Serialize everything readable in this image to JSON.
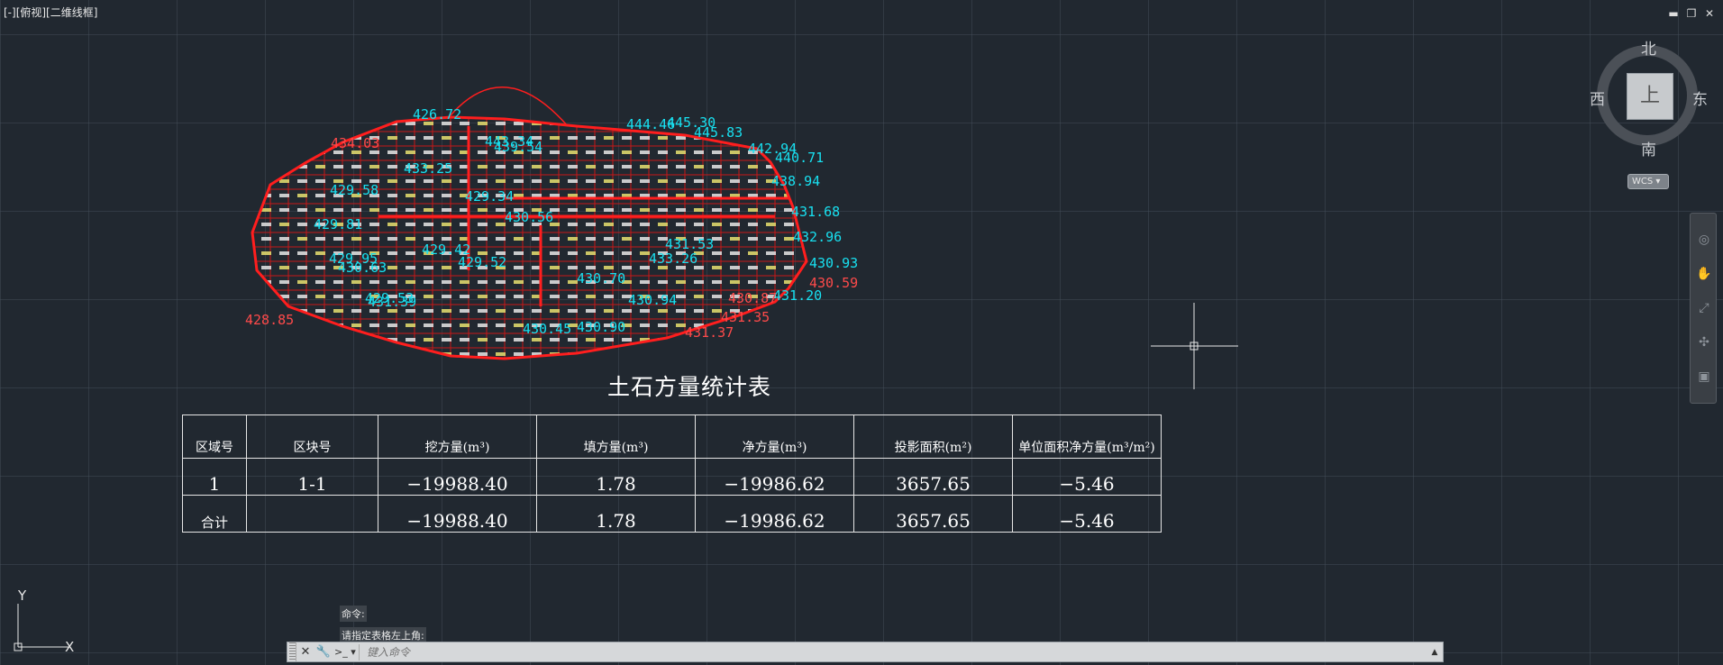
{
  "viewport": {
    "label": "[-][俯视][二维线框]"
  },
  "window_controls": {
    "minimize": "▬",
    "restore": "❐",
    "close": "✕"
  },
  "viewcube": {
    "north": "北",
    "south": "南",
    "west": "西",
    "east": "东",
    "face": "上",
    "wcs": "WCS ▾"
  },
  "navbar": {
    "icons": [
      "steering-wheel-icon",
      "pan-icon",
      "zoom-icon",
      "orbit-icon",
      "showmotion-icon"
    ]
  },
  "drawing": {
    "labels": [
      {
        "t": "426.72",
        "c": "cyan"
      },
      {
        "t": "434.03",
        "c": "red"
      },
      {
        "t": "439.54",
        "c": "cyan"
      },
      {
        "t": "443.34",
        "c": "cyan"
      },
      {
        "t": "444.46",
        "c": "cyan"
      },
      {
        "t": "445.30",
        "c": "cyan"
      },
      {
        "t": "445.83",
        "c": "cyan"
      },
      {
        "t": "442.94",
        "c": "cyan"
      },
      {
        "t": "440.71",
        "c": "cyan"
      },
      {
        "t": "438.94",
        "c": "cyan"
      },
      {
        "t": "431.68",
        "c": "cyan"
      },
      {
        "t": "432.96",
        "c": "cyan"
      },
      {
        "t": "430.93",
        "c": "cyan"
      },
      {
        "t": "431.20",
        "c": "cyan"
      },
      {
        "t": "430.59",
        "c": "red"
      },
      {
        "t": "430.87",
        "c": "red"
      },
      {
        "t": "431.35",
        "c": "red"
      },
      {
        "t": "431.37",
        "c": "red"
      },
      {
        "t": "430.94",
        "c": "cyan"
      },
      {
        "t": "430.90",
        "c": "cyan"
      },
      {
        "t": "430.45",
        "c": "cyan"
      },
      {
        "t": "429.53",
        "c": "cyan"
      },
      {
        "t": "429.81",
        "c": "cyan"
      },
      {
        "t": "429.95",
        "c": "cyan"
      },
      {
        "t": "430.63",
        "c": "cyan"
      },
      {
        "t": "428.85",
        "c": "red"
      },
      {
        "t": "430.70",
        "c": "cyan"
      },
      {
        "t": "429.34",
        "c": "cyan"
      },
      {
        "t": "429.42",
        "c": "cyan"
      },
      {
        "t": "430.56",
        "c": "cyan"
      },
      {
        "t": "431.53",
        "c": "cyan"
      },
      {
        "t": "433.25",
        "c": "cyan"
      },
      {
        "t": "431.39",
        "c": "cyan"
      },
      {
        "t": "429.58",
        "c": "cyan"
      },
      {
        "t": "433.26",
        "c": "cyan"
      },
      {
        "t": "429.52",
        "c": "cyan"
      }
    ]
  },
  "table": {
    "title": "土石方量统计表",
    "headers": [
      "区域号",
      "区块号",
      "挖方量(m³)",
      "填方量(m³)",
      "净方量(m³)",
      "投影面积(m²)",
      "单位面积净方量(m³/m²)"
    ],
    "rows": [
      [
        "1",
        "1-1",
        "−19988.40",
        "1.78",
        "−19986.62",
        "3657.65",
        "−5.46"
      ],
      [
        "合计",
        "",
        "−19988.40",
        "1.78",
        "−19986.62",
        "3657.65",
        "−5.46"
      ]
    ]
  },
  "ucs": {
    "x": "X",
    "y": "Y"
  },
  "command": {
    "history": [
      "命令:",
      "请指定表格左上角:"
    ],
    "placeholder": "键入命令",
    "close": "✕",
    "customize": "🔧",
    "prompt": ">_ ▾",
    "expand": "▲"
  },
  "colors": {
    "background": "#212830",
    "cyan": "#18e0f0",
    "red": "#ff1e1e",
    "yellow": "#e8e070"
  }
}
